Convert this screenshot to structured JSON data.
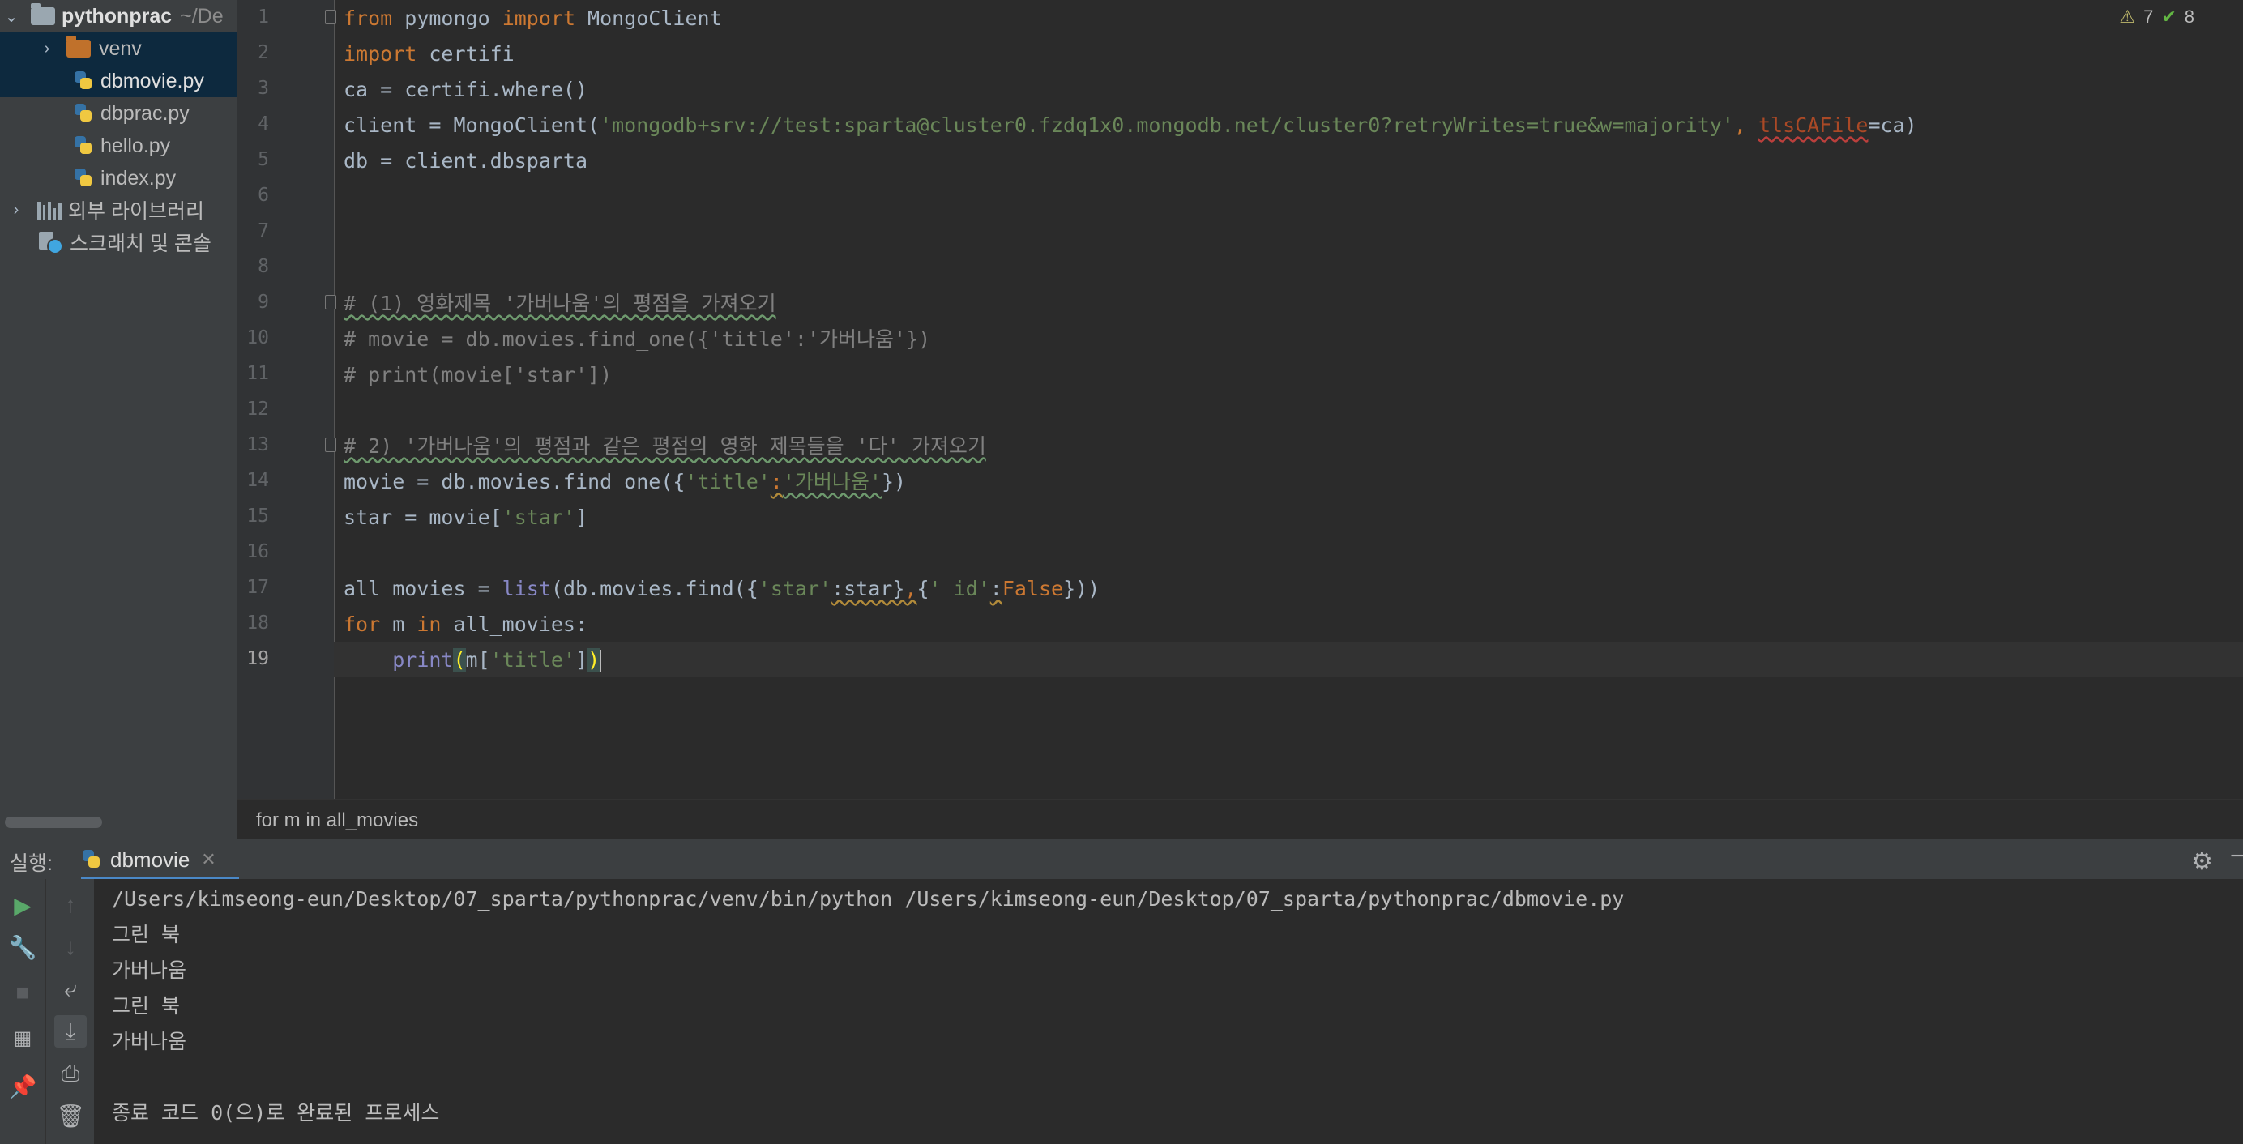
{
  "project": {
    "root_name": "pythonprac",
    "root_path": "~/De",
    "items": [
      {
        "label": "venv",
        "type": "folder"
      },
      {
        "label": "dbmovie.py",
        "type": "python"
      },
      {
        "label": "dbprac.py",
        "type": "python"
      },
      {
        "label": "hello.py",
        "type": "python"
      },
      {
        "label": "index.py",
        "type": "python"
      },
      {
        "label": "외부 라이브러리",
        "type": "library"
      },
      {
        "label": "스크래치 및 콘솔",
        "type": "scratch"
      }
    ]
  },
  "editor": {
    "warnings": "7",
    "weak_warnings": "8",
    "line_numbers": [
      "1",
      "2",
      "3",
      "4",
      "5",
      "6",
      "7",
      "8",
      "9",
      "10",
      "11",
      "12",
      "13",
      "14",
      "15",
      "16",
      "17",
      "18",
      "19"
    ],
    "current_line": "19",
    "lines": {
      "l1_kw1": "from",
      "l1_mod": " pymongo ",
      "l1_kw2": "import",
      "l1_name": " MongoClient",
      "l2_kw": "import",
      "l2_mod": " certifi",
      "l3": "ca = certifi.where()",
      "l4_a": "client = MongoClient(",
      "l4_str": "'mongodb+srv://test:sparta@cluster0.fzdq1x0.mongodb.net/cluster0?retryWrites=true&w=majority'",
      "l4_comma": ", ",
      "l4_param": "tlsCAFile",
      "l4_b": "=ca)",
      "l5": "db = client.dbsparta",
      "l9": "# (1) 영화제목 '가버나움'의 평점을 가져오기",
      "l10": "# movie = db.movies.find_one({'title':'가버나움'})",
      "l11": "# print(movie['star'])",
      "l13": "# 2) '가버나움'의 평점과 같은 평점의 영화 제목들을 '다' 가져오기",
      "l14_a": "movie = db.movies.find_one({",
      "l14_s1": "'title'",
      "l14_colon": ":",
      "l14_s2": "'가버나움'",
      "l14_b": "})",
      "l15_a": "star = movie[",
      "l15_s": "'star'",
      "l15_b": "]",
      "l17_a": "all_movies = ",
      "l17_list": "list",
      "l17_b": "(db.movies.find({",
      "l17_s1": "'star'",
      "l17_c": ":star}",
      "l17_comma": ",",
      "l17_d": "{",
      "l17_s2": "'_id'",
      "l17_e": ":",
      "l17_false": "False",
      "l17_f": "}))",
      "l18_for": "for",
      "l18_a": " m ",
      "l18_in": "in",
      "l18_b": " all_movies:",
      "l19_indent": "    ",
      "l19_print": "print",
      "l19_open": "(",
      "l19_a": "m[",
      "l19_s": "'title'",
      "l19_b": "]",
      "l19_close": ")"
    }
  },
  "breadcrumb": "for m in all_movies",
  "run": {
    "label": "실행:",
    "tab_name": "dbmovie",
    "output": [
      "/Users/kimseong-eun/Desktop/07_sparta/pythonprac/venv/bin/python /Users/kimseong-eun/Desktop/07_sparta/pythonprac/dbmovie.py",
      "그린 북",
      "가버나움",
      "그린 북",
      "가버나움",
      "",
      "종료 코드 0(으)로 완료된 프로세스"
    ]
  },
  "colors": {
    "keyword": "#cc7832",
    "string": "#6a8759",
    "comment": "#808080",
    "builtin": "#8888c6",
    "selection": "#0d293e",
    "accent": "#4a88c7"
  }
}
